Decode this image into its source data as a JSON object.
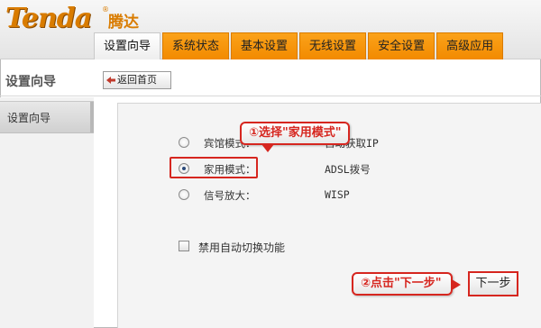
{
  "brand": {
    "logo": "Tenda",
    "logo_cn": "腾达",
    "reg": "®"
  },
  "tabs": [
    {
      "label": "设置向导",
      "active": true
    },
    {
      "label": "系统状态"
    },
    {
      "label": "基本设置"
    },
    {
      "label": "无线设置"
    },
    {
      "label": "安全设置"
    },
    {
      "label": "高级应用"
    }
  ],
  "left": {
    "title": "设置向导",
    "home_button": "返回首页",
    "side_item": "设置向导"
  },
  "modes": [
    {
      "label": "宾馆模式：",
      "desc": "自动获取IP",
      "checked": false
    },
    {
      "label": "家用模式：",
      "desc": "ADSL拨号",
      "checked": true
    },
    {
      "label": "信号放大：",
      "desc": "WISP",
      "checked": false
    }
  ],
  "auto_switch": {
    "label": "禁用自动切换功能",
    "checked": false
  },
  "callouts": {
    "step1": "①选择\"家用模式\"",
    "step2": "②点击\"下一步\""
  },
  "next_button": "下一步",
  "colors": {
    "accent": "#f28a00",
    "highlight": "#d6261f"
  }
}
